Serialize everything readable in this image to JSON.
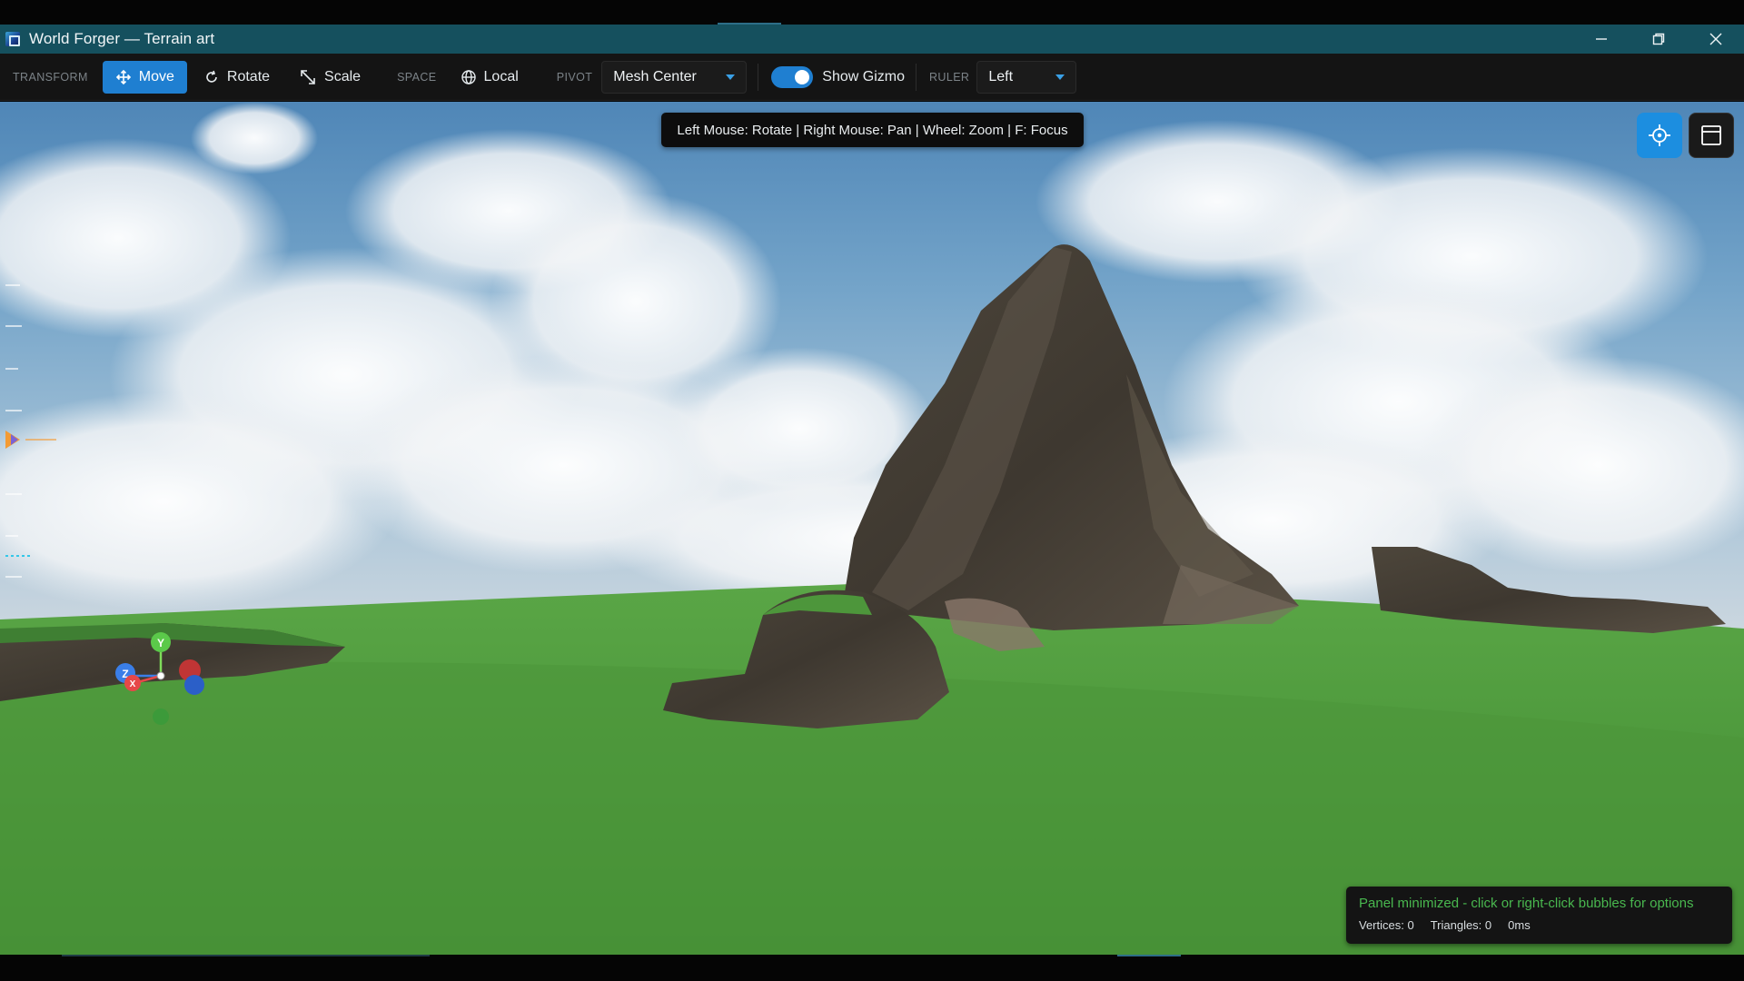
{
  "window": {
    "title": "World Forger — Terrain art"
  },
  "toolbar": {
    "transform_label": "TRANSFORM",
    "move_label": "Move",
    "rotate_label": "Rotate",
    "scale_label": "Scale",
    "space_label": "SPACE",
    "space_value": "Local",
    "pivot_label": "PIVOT",
    "pivot_value": "Mesh Center",
    "gizmo_toggle_on": true,
    "gizmo_label": "Show Gizmo",
    "ruler_label": "RULER",
    "ruler_value": "Left"
  },
  "viewport": {
    "hint": "Left Mouse: Rotate | Right Mouse: Pan | Wheel: Zoom | F: Focus",
    "gizmo_axes": {
      "y": "Y",
      "z": "Z",
      "x": "X"
    }
  },
  "status": {
    "message": "Panel minimized - click or right-click bubbles for options",
    "vertices": "Vertices: 0",
    "triangles": "Triangles: 0",
    "time": "0ms"
  },
  "colors": {
    "accent": "#1f7fd1",
    "title_bar": "#15505e",
    "status_text": "#49b84f",
    "grass": "#4f9a3c",
    "rock": "#4a4237"
  },
  "icons": {
    "app": "app-icon",
    "move": "move-arrows-icon",
    "rotate": "rotate-icon",
    "scale": "scale-arrow-icon",
    "space": "globe-icon",
    "focus": "crosshair-icon",
    "panel": "panel-layout-icon"
  }
}
